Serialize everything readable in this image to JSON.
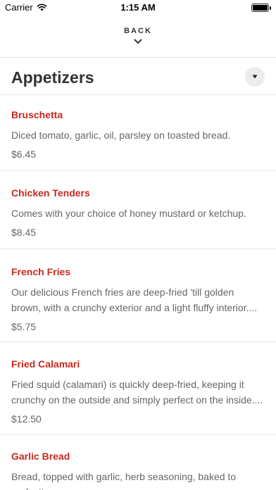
{
  "status_bar": {
    "carrier": "Carrier",
    "time": "1:15 AM"
  },
  "nav": {
    "back_label": "BACK"
  },
  "section": {
    "title": "Appetizers"
  },
  "items": [
    {
      "name": "Bruschetta",
      "description": "Diced tomato, garlic, oil, parsley on toasted bread.",
      "price": "$6.45"
    },
    {
      "name": "Chicken Tenders",
      "description": "Comes with your choice of honey mustard or ketchup.",
      "price": "$8.45"
    },
    {
      "name": "French Fries",
      "description": "Our delicious French fries are deep-fried 'till golden brown, with a crunchy exterior and a light fluffy interior....",
      "price": "$5.75"
    },
    {
      "name": "Fried Calamari",
      "description": "Fried squid (calamari) is quickly deep-fried, keeping it crunchy on the outside and simply perfect on the inside....",
      "price": "$12.50"
    },
    {
      "name": "Garlic Bread",
      "description": "Bread, topped with garlic, herb seasoning, baked to perfection.",
      "price": ""
    }
  ],
  "colors": {
    "item_name": "#c8281e",
    "text_muted": "#666666",
    "divider": "#e5e5e5"
  }
}
